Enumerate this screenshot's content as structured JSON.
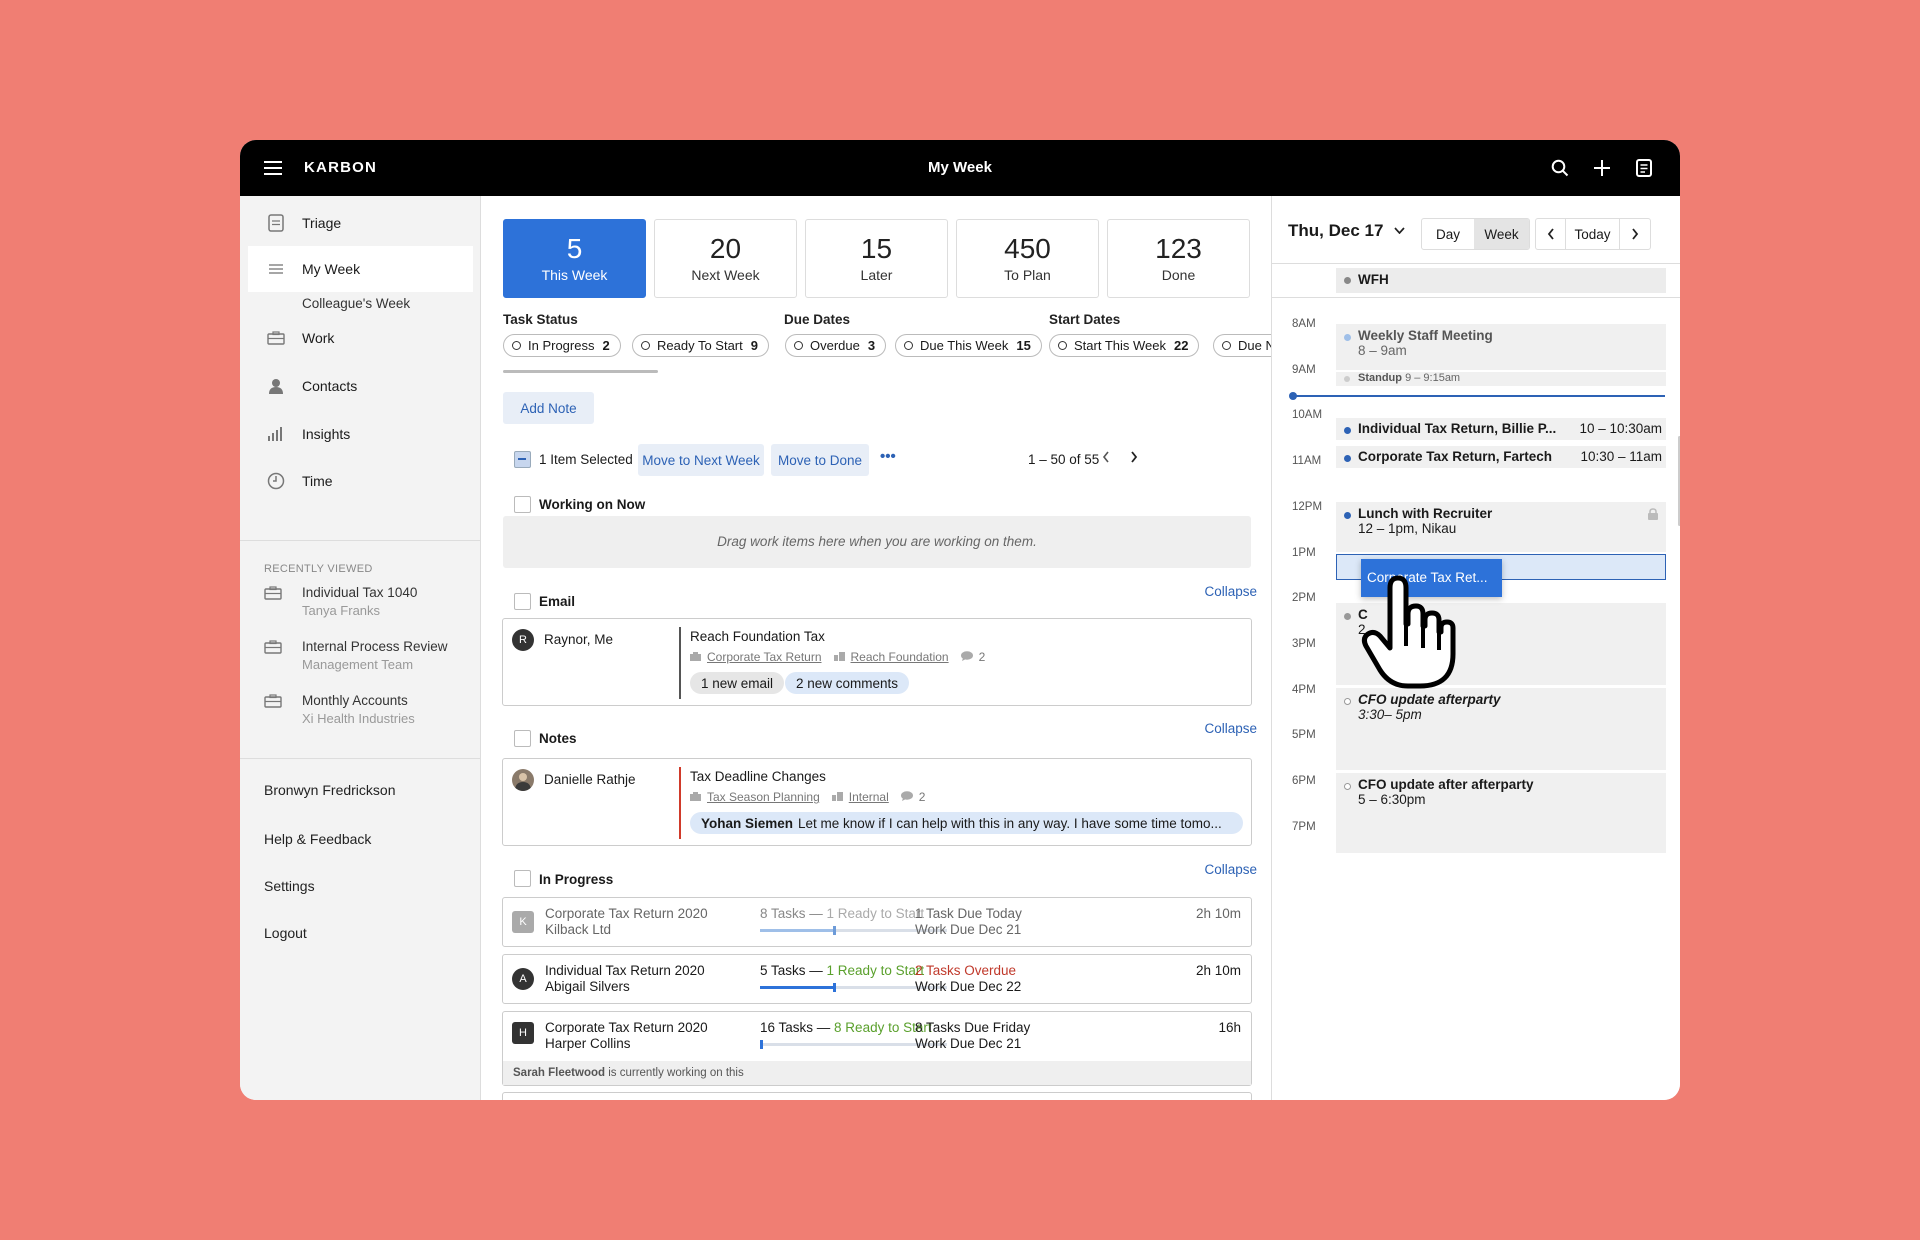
{
  "topbar": {
    "brand": "KARBON",
    "title": "My Week"
  },
  "sidebar": {
    "items": [
      {
        "label": "Triage",
        "icon": "document-icon"
      },
      {
        "label": "My Week",
        "icon": "list-icon"
      },
      {
        "label": "Colleague's Week"
      },
      {
        "label": "Work",
        "icon": "briefcase-icon"
      },
      {
        "label": "Contacts",
        "icon": "person-icon"
      },
      {
        "label": "Insights",
        "icon": "bar-chart-icon"
      },
      {
        "label": "Time",
        "icon": "clock-icon"
      }
    ],
    "recently_viewed_heading": "RECENTLY VIEWED",
    "recent": [
      {
        "title": "Individual Tax 1040",
        "subtitle": "Tanya Franks"
      },
      {
        "title": "Internal Process Review",
        "subtitle": "Management Team"
      },
      {
        "title": "Monthly Accounts",
        "subtitle": "Xi Health Industries"
      }
    ],
    "user": "Bronwyn Fredrickson",
    "help": "Help & Feedback",
    "settings": "Settings",
    "logout": "Logout"
  },
  "stats": [
    {
      "num": "5",
      "label": "This Week"
    },
    {
      "num": "20",
      "label": "Next Week"
    },
    {
      "num": "15",
      "label": "Later"
    },
    {
      "num": "450",
      "label": "To Plan"
    },
    {
      "num": "123",
      "label": "Done"
    }
  ],
  "filters": {
    "task_status": "Task Status",
    "due_dates": "Due Dates",
    "start_dates": "Start Dates",
    "chips": [
      {
        "label": "In Progress",
        "count": "2"
      },
      {
        "label": "Ready To Start",
        "count": "9"
      },
      {
        "label": "Overdue",
        "count": "3"
      },
      {
        "label": "Due This Week",
        "count": "15"
      },
      {
        "label": "Start This Week",
        "count": "22"
      },
      {
        "label": "Due N",
        "count": ""
      }
    ]
  },
  "toolbar": {
    "add_note": "Add Note",
    "selected": "1 Item Selected",
    "move_next": "Move to Next Week",
    "move_done": "Move to Done",
    "more": "•••",
    "paging": "1 – 50 of 55"
  },
  "working_now": {
    "label": "Working on Now",
    "drop": "Drag work items here when you are working on them."
  },
  "email": {
    "label": "Email",
    "collapse": "Collapse",
    "card": {
      "initial": "R",
      "name": "Raynor, Me",
      "title": "Reach Foundation Tax",
      "meta1": "Corporate Tax Return",
      "meta2": "Reach Foundation",
      "comments": "2",
      "pill1": "1 new email",
      "pill2": "2 new comments"
    }
  },
  "notes": {
    "label": "Notes",
    "collapse": "Collapse",
    "card": {
      "name": "Danielle Rathje",
      "title": "Tax Deadline Changes",
      "meta1": "Tax Season Planning",
      "meta2": "Internal",
      "comments": "2",
      "author": "Yohan Siemen",
      "message": "Let me know if I can help with this in any way. I have some time tomo..."
    }
  },
  "in_progress": {
    "label": "In Progress",
    "collapse": "Collapse",
    "rows": [
      {
        "initial": "K",
        "title": "Corporate Tax Return 2020",
        "client": "Kilback Ltd",
        "tasks": "8 Tasks — ",
        "ready": "1 Ready to Start",
        "due1": "1 Task Due Today",
        "due2": "Work Due Dec 21",
        "time": "2h 10m",
        "progress": 0.4
      },
      {
        "initial": "A",
        "title": "Individual Tax Return 2020",
        "client": "Abigail Silvers",
        "tasks": "5 Tasks — ",
        "ready": "1 Ready to Start",
        "due1": "2 Tasks Overdue",
        "due2": "Work Due Dec 22",
        "time": "2h 10m",
        "progress": 0.4
      },
      {
        "initial": "H",
        "title": "Corporate Tax Return 2020",
        "client": "Harper Collins",
        "tasks": "16 Tasks — ",
        "ready": "8 Ready to Start",
        "due1": "8 Tasks Due Friday",
        "due2": "Work Due Dec 21",
        "time": "16h",
        "progress": 0.0,
        "working_name": "Sarah Fleetwood",
        "working_text": " is currently working on this"
      }
    ]
  },
  "calendar": {
    "date": "Thu, Dec 17",
    "view_day": "Day",
    "view_week": "Week",
    "today": "Today",
    "all_day": "WFH",
    "hours": [
      "8AM",
      "9AM",
      "10AM",
      "11AM",
      "12PM",
      "1PM",
      "2PM",
      "3PM",
      "4PM",
      "5PM",
      "6PM",
      "7PM"
    ],
    "events": [
      {
        "title": "Weekly Staff Meeting",
        "time": "8 – 9am"
      },
      {
        "title": "Standup",
        "time": "9 – 9:15am"
      },
      {
        "title": "Individual Tax Return, Billie P...",
        "time": "10 – 10:30am"
      },
      {
        "title": "Corporate Tax Return, Fartech",
        "time": "10:30 – 11am"
      },
      {
        "title": "Lunch with Recruiter",
        "time": "12 – 1pm, Nikau"
      },
      {
        "title": "C",
        "time": "2"
      },
      {
        "title": "CFO update afterparty",
        "time": "3:30– 5pm"
      },
      {
        "title": "CFO update after afterparty",
        "time": "5 – 6:30pm"
      }
    ],
    "drag_label": "Corporate Tax Ret..."
  },
  "colors": {
    "accent": "#2d72d9",
    "background": "#f07e73",
    "topbar": "#000000",
    "overdue": "#c0392b",
    "ready": "#5aa02c"
  }
}
